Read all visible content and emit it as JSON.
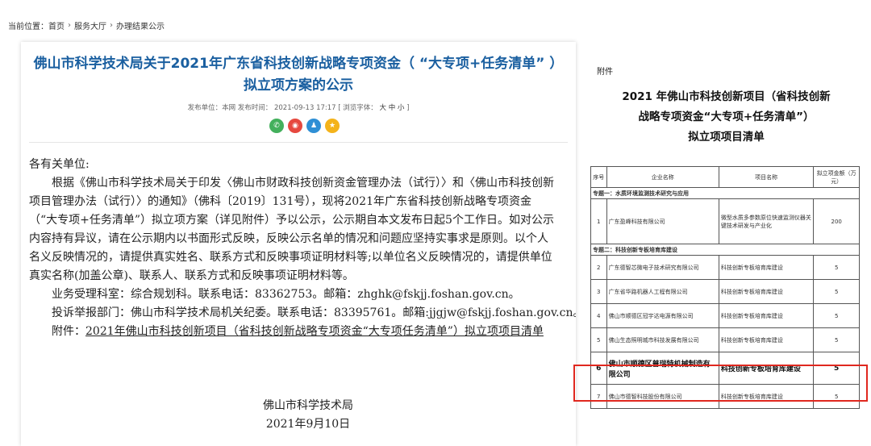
{
  "breadcrumb": {
    "prefix": "当前位置：",
    "items": [
      "首页",
      "服务大厅",
      "办理结果公示"
    ]
  },
  "article": {
    "title": "佛山市科学技术局关于2021年广东省科技创新战略专项资金（ “大专项+任务清单” ）拟立项方案的公示",
    "meta_publisher": "发布单位：本网  发布时间：  2021-09-13 17:17  [ 浏览字体：",
    "meta_sizes": "大 中 小",
    "meta_end": "]",
    "paragraphs": {
      "salutation": "各有关单位:",
      "p1_l1": "根据《佛山市科学技术局关于印发〈佛山市财政科技创新资金管理办法（试行）〉和〈佛山市科技创新",
      "p1_l2": "项目管理办法（试行）〉的通知》（佛科〔2019〕131号），现将2021年广东省科技创新战略专项资金",
      "p1_l3": "（“大专项+任务清单”）拟立项方案（详见附件）予以公示，公示期自本文发布日起5个工作日。如对公示",
      "p1_l4": "内容持有异议，请在公示期内以书面形式反映，反映公示名单的情况和问题应坚持实事求是原则。以个人",
      "p1_l5": "名义反映情况的，请提供真实姓名、联系方式和反映事项证明材料等;以单位名义反映情况的，请提供单位",
      "p1_l6": "真实名称(加盖公章)、联系人、联系方式和反映事项证明材料等。",
      "p2": "业务受理科室：综合规划科。联系电话：83362753。邮箱：zhghk@fskjj.foshan.gov.cn。",
      "p3": "投诉举报部门：佛山市科学技术局机关纪委。联系电话：83395761。邮箱:jjgjw@fskjj.foshan.gov.cn。",
      "p4_prefix": "附件：",
      "p4_link": "2021年佛山市科技创新项目（省科技创新战略专项资金“大专项任务清单”）拟立项项目清单"
    },
    "signature": {
      "org": "佛山市科学技术局",
      "date": "2021年9月10日"
    }
  },
  "attachment": {
    "label": "附件",
    "heading_l1": "2021 年佛山市科技创新项目（省科技创新",
    "heading_l2": "战略专项资金“大专项+任务清单”）",
    "heading_l3": "拟立项项目清单",
    "table": {
      "headers": [
        "序号",
        "企业名称",
        "项目名称",
        "拟立项金额（万元）"
      ],
      "section1": "专题一：水质环境监测技术研究与应用",
      "row1": [
        "1",
        "广东盈峰科技有限公司",
        "微型水质多参数原位快速监测仪器关键技术研发与产业化",
        "200"
      ],
      "section2": "专题二：科技创新专板培育库建设",
      "rows": [
        [
          "2",
          "广东德智芯微电子技术研究有限公司",
          "科技创新专板培育库建设",
          "5"
        ],
        [
          "3",
          "广东省华路机器人工程有限公司",
          "科技创新专板培育库建设",
          "5"
        ],
        [
          "4",
          "佛山市顺德区冠宇达电源有限公司",
          "科技创新专板培育库建设",
          "5"
        ],
        [
          "5",
          "佛山生态照明城市科技发展有限公司",
          "科技创新专板培育库建设",
          "5"
        ]
      ],
      "highlight_row": [
        "6",
        "佛山市顺德区普瑞特机械制造有限公司",
        "科技创新专板培育库建设",
        "5"
      ],
      "last_row": [
        "7",
        "佛山市德智科技股份有限公司",
        "科技创新专板培育库建设",
        "5"
      ]
    }
  }
}
